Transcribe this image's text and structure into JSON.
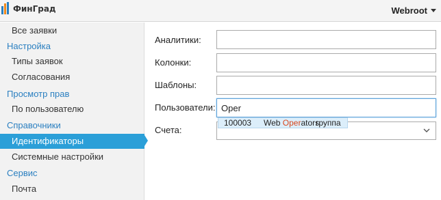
{
  "header": {
    "brand": "ФинГрад",
    "user": "Webroot",
    "logo_icon": "fingrad-logo-icon",
    "colors": {
      "logo_orange": "#f08a1c",
      "logo_blue": "#2a7fc0"
    }
  },
  "sidebar": {
    "items": [
      {
        "label": "Все заявки",
        "kind": "sub"
      },
      {
        "label": "Настройка",
        "kind": "section"
      },
      {
        "label": "Типы заявок",
        "kind": "sub"
      },
      {
        "label": "Согласования",
        "kind": "sub"
      },
      {
        "label": "Просмотр прав",
        "kind": "section"
      },
      {
        "label": "По пользователю",
        "kind": "sub"
      },
      {
        "label": "Справочники",
        "kind": "section"
      },
      {
        "label": "Идентификаторы",
        "kind": "sub",
        "active": true
      },
      {
        "label": "Системные настройки",
        "kind": "sub"
      },
      {
        "label": "Сервис",
        "kind": "section"
      },
      {
        "label": "Почта",
        "kind": "sub"
      }
    ],
    "colors": {
      "section": "#2a7fc0",
      "active_bg": "#2b9fd8"
    }
  },
  "form": {
    "analytics_label": "Аналитики:",
    "analytics_value": "",
    "columns_label": "Колонки:",
    "columns_value": "",
    "templates_label": "Шаблоны:",
    "templates_value": "",
    "users_label": "Пользователи:",
    "users_value": "Oper",
    "accounts_label": "Счета:",
    "accounts_value": ""
  },
  "suggestion": {
    "id": "100003",
    "name_prefix": "Web ",
    "name_highlight": "Oper",
    "name_suffix": "ators",
    "type": "группа",
    "colors": {
      "bg": "#dceefa",
      "highlight": "#d9461c"
    }
  }
}
